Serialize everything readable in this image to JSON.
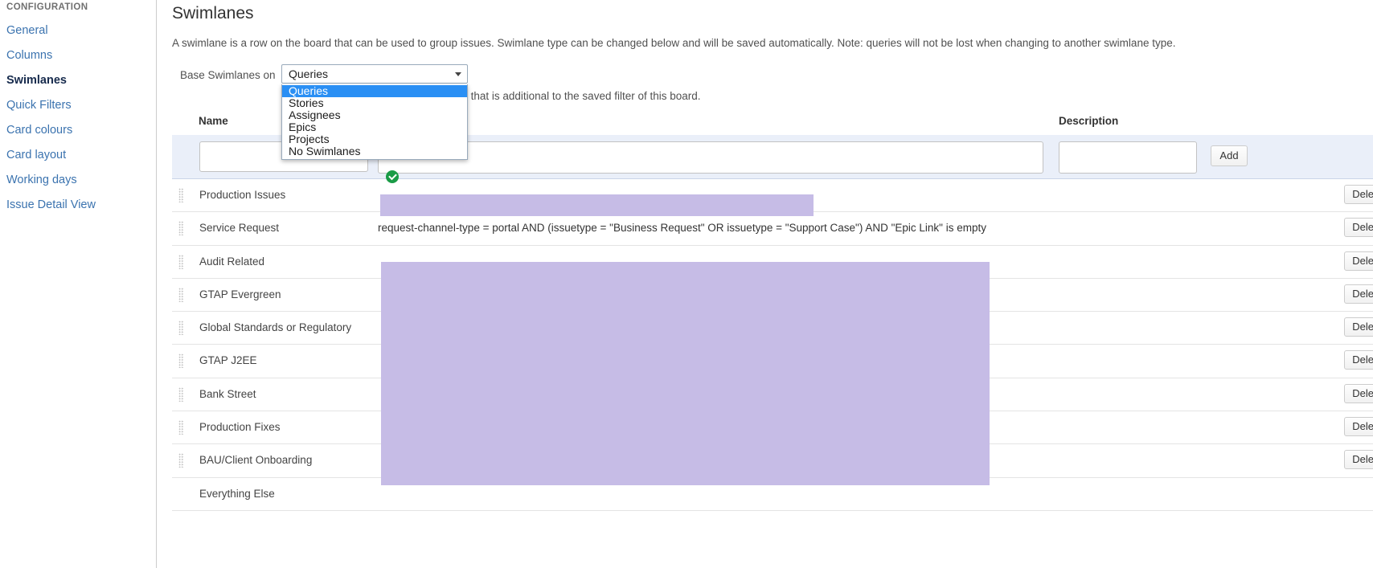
{
  "sidebar": {
    "heading": "CONFIGURATION",
    "items": [
      {
        "label": "General",
        "active": false
      },
      {
        "label": "Columns",
        "active": false
      },
      {
        "label": "Swimlanes",
        "active": true
      },
      {
        "label": "Quick Filters",
        "active": false
      },
      {
        "label": "Card colours",
        "active": false
      },
      {
        "label": "Card layout",
        "active": false
      },
      {
        "label": "Working days",
        "active": false
      },
      {
        "label": "Issue Detail View",
        "active": false
      }
    ]
  },
  "page": {
    "title": "Swimlanes",
    "description": "A swimlane is a row on the board that can be used to group issues. Swimlane type can be changed below and will be saved automatically. Note: queries will not be lost when changing to another swimlane type."
  },
  "base_swimlanes": {
    "label": "Base Swimlanes on",
    "selected": "Queries",
    "options": [
      "Queries",
      "Stories",
      "Assignees",
      "Epics",
      "Projects",
      "No Swimlanes"
    ],
    "note": "Swimlanes are based on JQL that is additional to the saved filter of this board."
  },
  "table": {
    "headers": {
      "name": "Name",
      "description": "Description"
    },
    "add_row": {
      "name_value": "",
      "query_value": "",
      "description_value": "",
      "add_label": "Add",
      "jql_status": "valid-check-icon"
    },
    "delete_label": "Delete",
    "rows": [
      {
        "name": "Production Issues",
        "query": "",
        "description": ""
      },
      {
        "name": "Service Request",
        "query": "request-channel-type = portal AND (issuetype = \"Business Request\" OR issuetype = \"Support Case\") AND \"Epic Link\" is empty",
        "description": ""
      },
      {
        "name": "Audit Related",
        "query": "",
        "description": ""
      },
      {
        "name": "GTAP Evergreen",
        "query": "",
        "description": ""
      },
      {
        "name": "Global Standards or Regulatory",
        "query": "",
        "description": ""
      },
      {
        "name": "GTAP J2EE",
        "query": "",
        "description": ""
      },
      {
        "name": "Bank Street",
        "query": "",
        "description": ""
      },
      {
        "name": "Production Fixes",
        "query": "",
        "description": ""
      },
      {
        "name": "BAU/Client Onboarding",
        "query": "",
        "description": ""
      },
      {
        "name": "Everything Else",
        "query": "",
        "description": ""
      }
    ]
  },
  "colors": {
    "link": "#3b73af",
    "selection_highlight": "#c6bce6",
    "dropdown_selected": "#2a8ff4",
    "add_row_background": "#eaeff9",
    "valid_green": "#1a9b46"
  }
}
